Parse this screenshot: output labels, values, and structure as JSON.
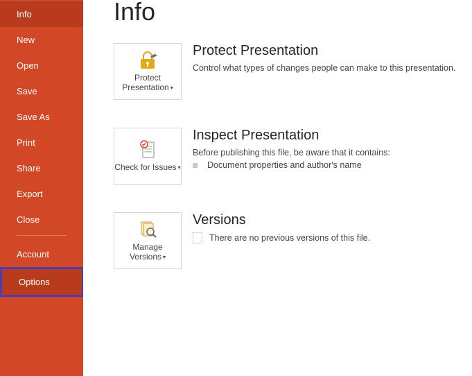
{
  "sidebar": {
    "items": [
      {
        "label": "Info",
        "active": true,
        "highlight": false
      },
      {
        "label": "New",
        "active": false,
        "highlight": false
      },
      {
        "label": "Open",
        "active": false,
        "highlight": false
      },
      {
        "label": "Save",
        "active": false,
        "highlight": false
      },
      {
        "label": "Save As",
        "active": false,
        "highlight": false
      },
      {
        "label": "Print",
        "active": false,
        "highlight": false
      },
      {
        "label": "Share",
        "active": false,
        "highlight": false
      },
      {
        "label": "Export",
        "active": false,
        "highlight": false
      },
      {
        "label": "Close",
        "active": false,
        "highlight": false
      }
    ],
    "bottom_items": [
      {
        "label": "Account",
        "active": false,
        "highlight": false
      },
      {
        "label": "Options",
        "active": false,
        "highlight": true
      }
    ]
  },
  "page": {
    "title": "Info"
  },
  "sections": {
    "protect": {
      "card_label": "Protect Presentation",
      "title": "Protect Presentation",
      "desc": "Control what types of changes people can make to this presentation."
    },
    "inspect": {
      "card_label": "Check for Issues",
      "title": "Inspect Presentation",
      "desc": "Before publishing this file, be aware that it contains:",
      "bullets": [
        "Document properties and author's name"
      ]
    },
    "versions": {
      "card_label": "Manage Versions",
      "title": "Versions",
      "desc": "There are no previous versions of this file."
    }
  }
}
